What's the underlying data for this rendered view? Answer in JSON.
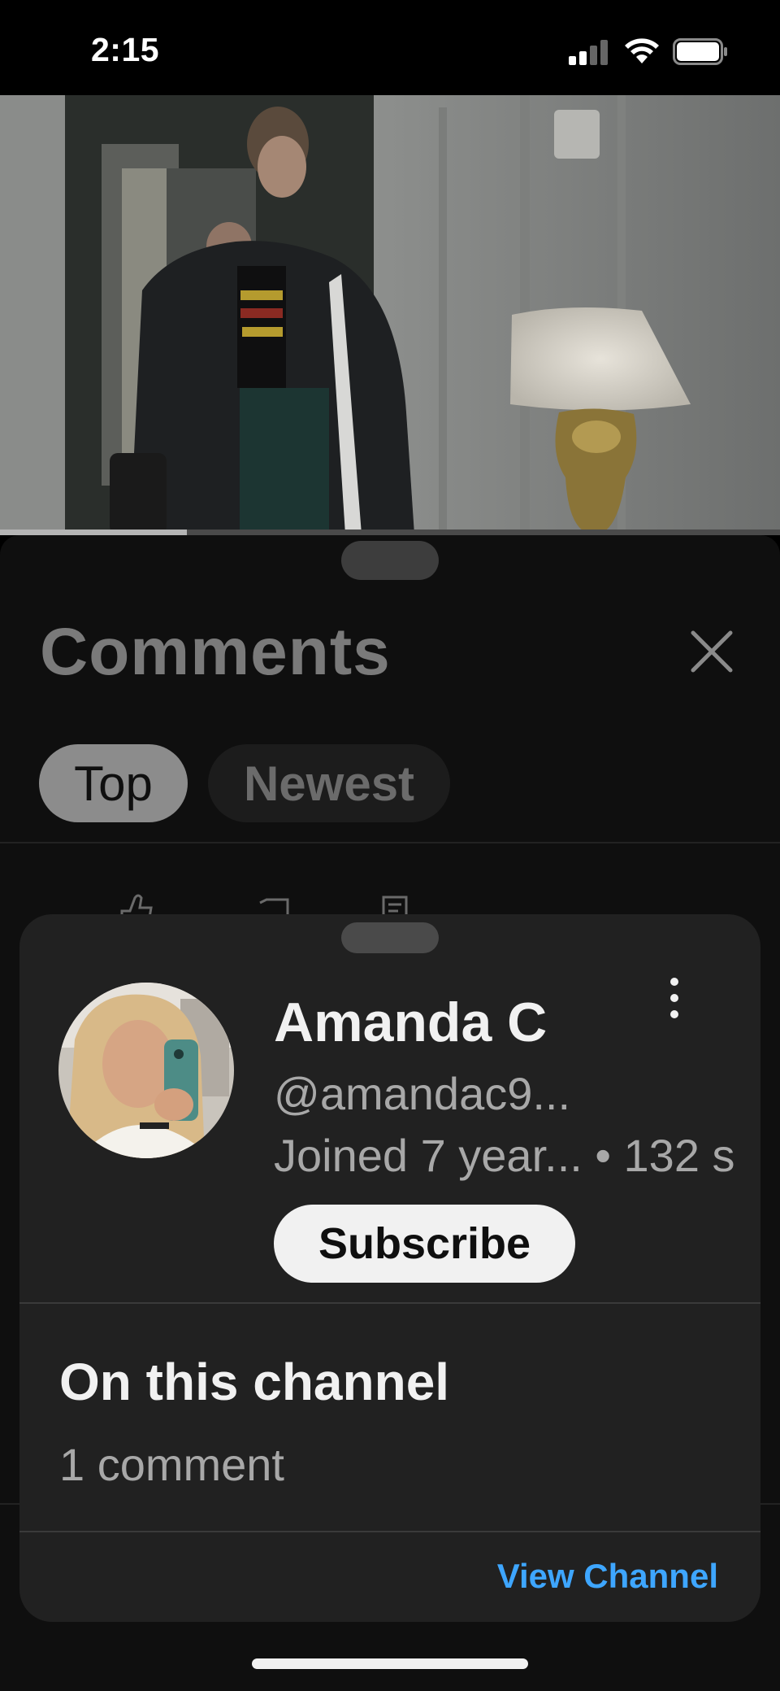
{
  "status_bar": {
    "time": "2:15",
    "icons": [
      "cellular-signal-icon",
      "wifi-icon",
      "battery-icon"
    ]
  },
  "video": {
    "progress": 0.24
  },
  "comments": {
    "title": "Comments",
    "close_icon": "close-icon",
    "filters": [
      {
        "label": "Top",
        "selected": true
      },
      {
        "label": "Newest",
        "selected": false
      }
    ],
    "peek_icons": [
      "thumbs-up-icon",
      "thumbs-down-icon",
      "comment-icon"
    ]
  },
  "channel_card": {
    "name": "Amanda C",
    "handle": "@amandac9...",
    "meta": "Joined 7 year... • 132 s",
    "subscribe_label": "Subscribe",
    "more_icon": "more-vertical-icon",
    "section_title": "On this channel",
    "section_count": "1 comment",
    "view_channel_label": "View Channel"
  },
  "colors": {
    "background": "#0f0f0f",
    "card": "#212121",
    "link": "#3ea6ff",
    "subscribe_bg": "#f1f1f1"
  }
}
